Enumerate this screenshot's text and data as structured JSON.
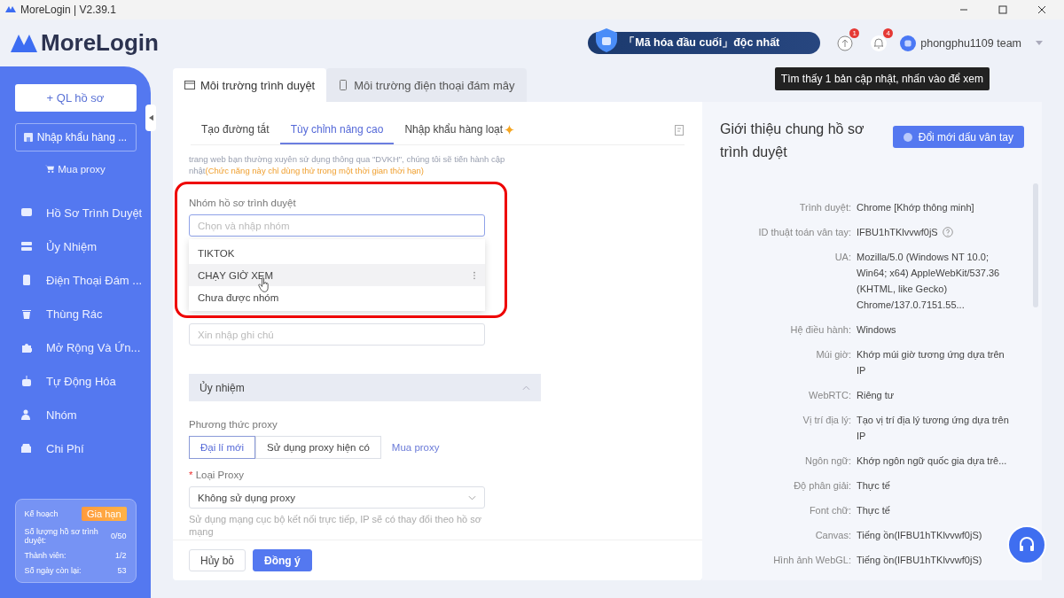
{
  "window": {
    "title": "MoreLogin | V2.39.1"
  },
  "logo": "MoreLogin",
  "header": {
    "banner": "「Mã hóa đầu cuối」độc nhất",
    "update_badge": "1",
    "bell_badge": "4",
    "user": "phongphu1109 team",
    "tooltip": "Tìm thấy 1 bản cập nhật, nhấn vào để xem"
  },
  "sidebar": {
    "new_button": "+ QL hồ sơ",
    "import_button": "Nhập khẩu hàng ...",
    "buy_link": "Mua proxy",
    "items": [
      {
        "label": "Hồ Sơ Trình Duyệt",
        "kind": "browser"
      },
      {
        "label": "Ủy Nhiệm",
        "kind": "proxy"
      },
      {
        "label": "Điện Thoại Đám ...",
        "kind": "phone"
      },
      {
        "label": "Thùng Rác",
        "kind": "trash"
      },
      {
        "label": "Mở Rộng Và Ứn...",
        "kind": "puzzle"
      },
      {
        "label": "Tự Động Hóa",
        "kind": "robot"
      },
      {
        "label": "Nhóm",
        "kind": "group"
      },
      {
        "label": "Chi Phí",
        "kind": "wallet"
      }
    ],
    "plan": {
      "title": "Kế hoạch",
      "badge": "Gia hạn",
      "rows": [
        {
          "label": "Số lượng hồ sơ trình duyệt:",
          "value": "0/50"
        },
        {
          "label": "Thành viên:",
          "value": "1/2"
        },
        {
          "label": "Số ngày còn lại:",
          "value": "53"
        }
      ]
    }
  },
  "tabs": [
    {
      "label": "Môi trường trình duyệt",
      "selected": true
    },
    {
      "label": "Môi trường điện thoại đám mây",
      "selected": false
    }
  ],
  "subtabs": [
    {
      "label": "Tạo đường tắt",
      "selected": false,
      "sparkle": false
    },
    {
      "label": "Tùy chỉnh nâng cao",
      "selected": true,
      "sparkle": false
    },
    {
      "label": "Nhập khẩu hàng loạt",
      "selected": false,
      "sparkle": true
    }
  ],
  "form": {
    "note_line": "trang web bạn thường xuyên sử dụng thông qua \"DVKH\", chúng tôi sẽ tiến hành cập",
    "note_text": "nhật",
    "note_highlight": "(Chức năng này chỉ dùng thử trong một thời gian thời hạn)",
    "group_label": "Nhóm hồ sơ trình duyệt",
    "group_placeholder": "Chọn và nhập nhóm",
    "group_options": [
      {
        "label": "TIKTOK",
        "selected": false
      },
      {
        "label": "CHẠY GIỜ XEM",
        "selected": true
      },
      {
        "label": "Chưa được nhóm",
        "selected": false
      }
    ],
    "remark_placeholder": "Xin nhập ghi chú",
    "section": {
      "title": "Ủy nhiệm",
      "expanded": true
    },
    "proxy_method_label": "Phương thức proxy",
    "proxy_methods": [
      {
        "label": "Đại lí mới",
        "selected": true
      },
      {
        "label": "Sử dụng proxy hiện có",
        "selected": false
      }
    ],
    "buy_proxy": "Mua proxy",
    "proxy_type_label": "Loại Proxy",
    "proxy_type_required": "*",
    "proxy_type_value": "Không sử dụng proxy",
    "proxy_help": "Sử dụng mạng cục bộ kết nối trực tiếp, IP sẽ có thay đổi theo hồ sơ",
    "proxy_help_cut": "mạng",
    "cancel": "Hủy bỏ",
    "ok": "Đồng ý"
  },
  "overview": {
    "title": "Giới thiệu chung hồ sơ trình duyệt",
    "refresh_button": "Đổi mới dấu vân tay",
    "rows": [
      {
        "label": "Trình duyệt:",
        "value": "Chrome [Khớp thông minh]",
        "help": false
      },
      {
        "label": "ID thuật toán vân tay:",
        "value": "IFBU1hTKlvvwf0jS",
        "help": true
      },
      {
        "label": "UA:",
        "value": "Mozilla/5.0 (Windows NT 10.0; Win64; x64) AppleWebKit/537.36 (KHTML, like Gecko) Chrome/137.0.7151.55...",
        "help": false
      },
      {
        "label": "Hệ điều hành:",
        "value": "Windows",
        "help": false
      },
      {
        "label": "Múi giờ:",
        "value": "Khớp múi giờ tương ứng dựa trên IP",
        "help": false
      },
      {
        "label": "WebRTC:",
        "value": "Riêng tư",
        "help": false
      },
      {
        "label": "Vị trí địa lý:",
        "value": "Tạo vị trí địa lý tương ứng dựa trên IP",
        "help": false
      },
      {
        "label": "Ngôn ngữ:",
        "value": "Khớp ngôn ngữ quốc gia dựa trê...",
        "help": false
      },
      {
        "label": "Độ phân giải:",
        "value": "Thực tế",
        "help": false
      },
      {
        "label": "Font chữ:",
        "value": "Thực tế",
        "help": false
      },
      {
        "label": "Canvas:",
        "value": "Tiếng ồn(IFBU1hTKlvvwf0jS)",
        "help": false
      },
      {
        "label": "Hình ảnh WebGL:",
        "value": "Tiếng ồn(IFBU1hTKlvvwf0jS)",
        "help": false
      }
    ]
  }
}
